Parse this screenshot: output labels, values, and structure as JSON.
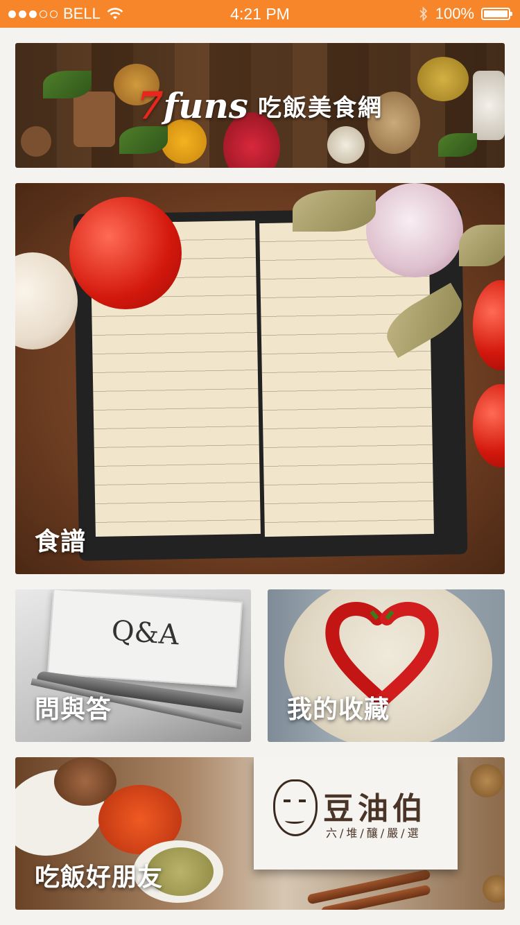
{
  "status_bar": {
    "carrier": "BELL",
    "time": "4:21 PM",
    "battery": "100%",
    "signal_bars_filled": 3,
    "signal_bars_total": 5,
    "accent": "#f7862a"
  },
  "banner": {
    "logo_number": "7",
    "logo_word": "funs",
    "site_name": "吃飯美食網"
  },
  "tiles": {
    "recipes": "食譜",
    "qa": "問與答",
    "qa_card": "Q&A",
    "favorites": "我的收藏",
    "partner": "吃飯好朋友"
  },
  "partner_logo": {
    "name": "豆油伯",
    "tagline": "六/堆/釀/嚴/選"
  },
  "icons": [
    "wifi-icon",
    "bluetooth-icon",
    "battery-icon"
  ]
}
